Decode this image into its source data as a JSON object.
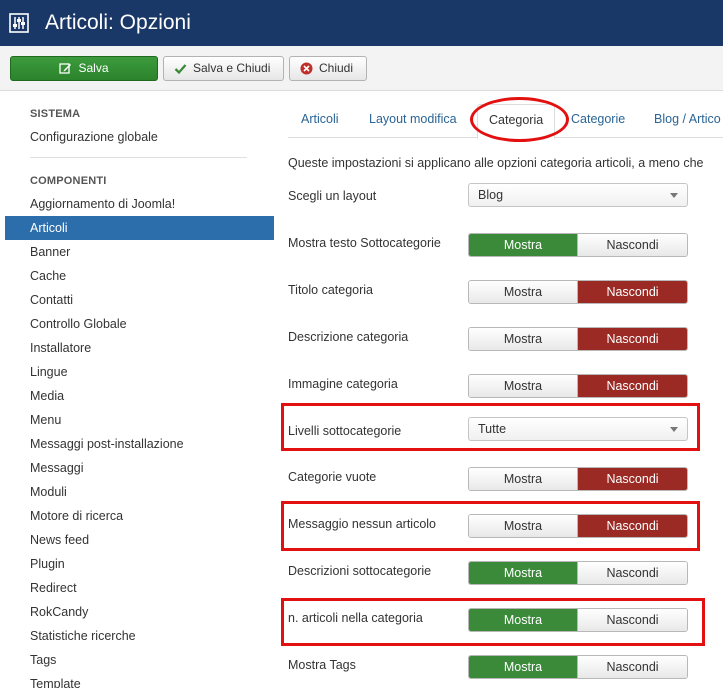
{
  "header": {
    "title": "Articoli: Opzioni",
    "icon": "options-sliders-icon"
  },
  "toolbar": {
    "save_label": "Salva",
    "save_close_label": "Salva e Chiudi",
    "close_label": "Chiudi"
  },
  "sidebar": {
    "section_system": "SISTEMA",
    "global_config": "Configurazione globale",
    "section_components": "COMPONENTI",
    "items": [
      "Aggiornamento di Joomla!",
      "Articoli",
      "Banner",
      "Cache",
      "Contatti",
      "Controllo Globale",
      "Installatore",
      "Lingue",
      "Media",
      "Menu",
      "Messaggi post-installazione",
      "Messaggi",
      "Moduli",
      "Motore di ricerca",
      "News feed",
      "Plugin",
      "Redirect",
      "RokCandy",
      "Statistiche ricerche",
      "Tags",
      "Template"
    ],
    "active_item": "Articoli"
  },
  "tabs": [
    "Articoli",
    "Layout modifica",
    "Categoria",
    "Categorie",
    "Blog / Artico"
  ],
  "active_tab": "Categoria",
  "description": "Queste impostazioni si applicano alle opzioni categoria articoli, a meno che",
  "fields": {
    "layout": {
      "label": "Scegli un layout",
      "value": "Blog"
    },
    "show_subcat_text": {
      "label": "Mostra testo Sottocategorie",
      "show": "Mostra",
      "hide": "Nascondi",
      "selected": "Mostra"
    },
    "category_title": {
      "label": "Titolo categoria",
      "show": "Mostra",
      "hide": "Nascondi",
      "selected": "Nascondi"
    },
    "category_desc": {
      "label": "Descrizione categoria",
      "show": "Mostra",
      "hide": "Nascondi",
      "selected": "Nascondi"
    },
    "category_image": {
      "label": "Immagine categoria",
      "show": "Mostra",
      "hide": "Nascondi",
      "selected": "Nascondi"
    },
    "subcat_levels": {
      "label": "Livelli sottocategorie",
      "value": "Tutte"
    },
    "empty_categories": {
      "label": "Categorie vuote",
      "show": "Mostra",
      "hide": "Nascondi",
      "selected": "Nascondi"
    },
    "no_articles_msg": {
      "label": "Messaggio nessun articolo",
      "show": "Mostra",
      "hide": "Nascondi",
      "selected": "Nascondi"
    },
    "subcat_desc": {
      "label": "Descrizioni sottocategorie",
      "show": "Mostra",
      "hide": "Nascondi",
      "selected": "Mostra"
    },
    "num_articles": {
      "label": "n. articoli nella categoria",
      "show": "Mostra",
      "hide": "Nascondi",
      "selected": "Mostra"
    },
    "show_tags": {
      "label": "Mostra Tags",
      "show": "Mostra",
      "hide": "Nascondi",
      "selected": "Mostra"
    }
  },
  "colors": {
    "header_bg": "#1a3867",
    "active_sidebar": "#2c6eab",
    "show_green": "#3a8a3a",
    "hide_red": "#9b2a24",
    "highlight": "#e31010"
  }
}
